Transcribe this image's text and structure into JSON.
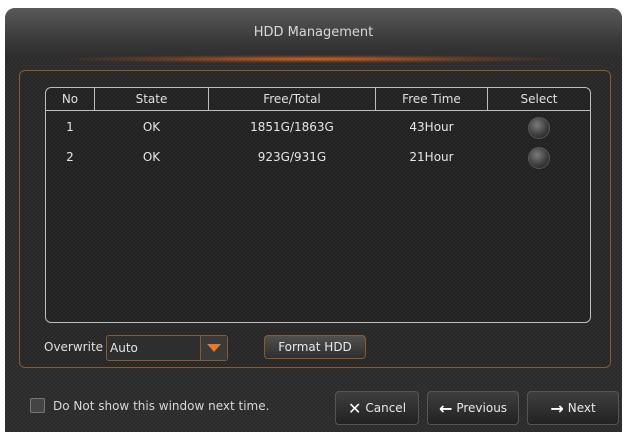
{
  "window": {
    "title": "HDD Management"
  },
  "table": {
    "headers": [
      "No",
      "State",
      "Free/Total",
      "Free Time",
      "Select"
    ],
    "rows": [
      {
        "no": "1",
        "state": "OK",
        "free_total": "1851G/1863G",
        "free_time": "43Hour"
      },
      {
        "no": "2",
        "state": "OK",
        "free_total": "923G/931G",
        "free_time": "21Hour"
      }
    ]
  },
  "overwrite": {
    "label": "Overwrite",
    "value": "Auto"
  },
  "format_button": "Format HDD",
  "footer": {
    "checkbox_label": "Do Not show this window next time.",
    "cancel_label": "Cancel",
    "previous_label": "Previous",
    "next_label": "Next"
  },
  "icons": {
    "cancel": "close-icon",
    "previous": "arrow-left-icon",
    "next": "arrow-right-icon",
    "dropdown": "caret-down-icon"
  },
  "colors": {
    "accent": "#e57a2a"
  }
}
